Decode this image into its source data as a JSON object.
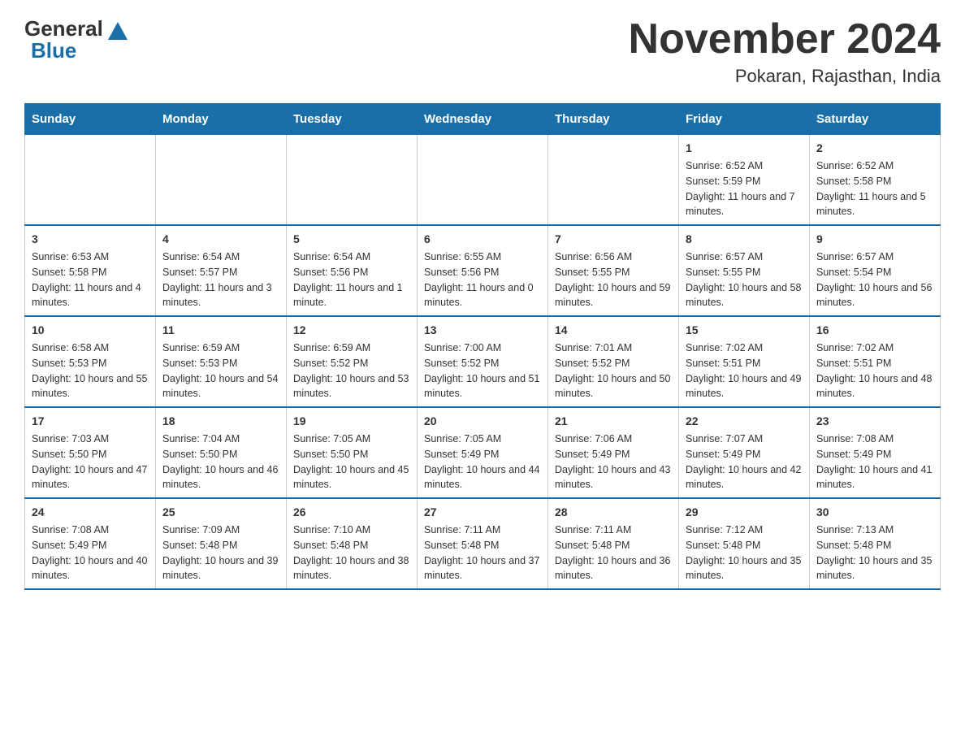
{
  "logo": {
    "general": "General",
    "blue": "Blue"
  },
  "title": {
    "month_year": "November 2024",
    "location": "Pokaran, Rajasthan, India"
  },
  "weekdays": [
    "Sunday",
    "Monday",
    "Tuesday",
    "Wednesday",
    "Thursday",
    "Friday",
    "Saturday"
  ],
  "weeks": [
    [
      {
        "day": "",
        "info": ""
      },
      {
        "day": "",
        "info": ""
      },
      {
        "day": "",
        "info": ""
      },
      {
        "day": "",
        "info": ""
      },
      {
        "day": "",
        "info": ""
      },
      {
        "day": "1",
        "info": "Sunrise: 6:52 AM\nSunset: 5:59 PM\nDaylight: 11 hours and 7 minutes."
      },
      {
        "day": "2",
        "info": "Sunrise: 6:52 AM\nSunset: 5:58 PM\nDaylight: 11 hours and 5 minutes."
      }
    ],
    [
      {
        "day": "3",
        "info": "Sunrise: 6:53 AM\nSunset: 5:58 PM\nDaylight: 11 hours and 4 minutes."
      },
      {
        "day": "4",
        "info": "Sunrise: 6:54 AM\nSunset: 5:57 PM\nDaylight: 11 hours and 3 minutes."
      },
      {
        "day": "5",
        "info": "Sunrise: 6:54 AM\nSunset: 5:56 PM\nDaylight: 11 hours and 1 minute."
      },
      {
        "day": "6",
        "info": "Sunrise: 6:55 AM\nSunset: 5:56 PM\nDaylight: 11 hours and 0 minutes."
      },
      {
        "day": "7",
        "info": "Sunrise: 6:56 AM\nSunset: 5:55 PM\nDaylight: 10 hours and 59 minutes."
      },
      {
        "day": "8",
        "info": "Sunrise: 6:57 AM\nSunset: 5:55 PM\nDaylight: 10 hours and 58 minutes."
      },
      {
        "day": "9",
        "info": "Sunrise: 6:57 AM\nSunset: 5:54 PM\nDaylight: 10 hours and 56 minutes."
      }
    ],
    [
      {
        "day": "10",
        "info": "Sunrise: 6:58 AM\nSunset: 5:53 PM\nDaylight: 10 hours and 55 minutes."
      },
      {
        "day": "11",
        "info": "Sunrise: 6:59 AM\nSunset: 5:53 PM\nDaylight: 10 hours and 54 minutes."
      },
      {
        "day": "12",
        "info": "Sunrise: 6:59 AM\nSunset: 5:52 PM\nDaylight: 10 hours and 53 minutes."
      },
      {
        "day": "13",
        "info": "Sunrise: 7:00 AM\nSunset: 5:52 PM\nDaylight: 10 hours and 51 minutes."
      },
      {
        "day": "14",
        "info": "Sunrise: 7:01 AM\nSunset: 5:52 PM\nDaylight: 10 hours and 50 minutes."
      },
      {
        "day": "15",
        "info": "Sunrise: 7:02 AM\nSunset: 5:51 PM\nDaylight: 10 hours and 49 minutes."
      },
      {
        "day": "16",
        "info": "Sunrise: 7:02 AM\nSunset: 5:51 PM\nDaylight: 10 hours and 48 minutes."
      }
    ],
    [
      {
        "day": "17",
        "info": "Sunrise: 7:03 AM\nSunset: 5:50 PM\nDaylight: 10 hours and 47 minutes."
      },
      {
        "day": "18",
        "info": "Sunrise: 7:04 AM\nSunset: 5:50 PM\nDaylight: 10 hours and 46 minutes."
      },
      {
        "day": "19",
        "info": "Sunrise: 7:05 AM\nSunset: 5:50 PM\nDaylight: 10 hours and 45 minutes."
      },
      {
        "day": "20",
        "info": "Sunrise: 7:05 AM\nSunset: 5:49 PM\nDaylight: 10 hours and 44 minutes."
      },
      {
        "day": "21",
        "info": "Sunrise: 7:06 AM\nSunset: 5:49 PM\nDaylight: 10 hours and 43 minutes."
      },
      {
        "day": "22",
        "info": "Sunrise: 7:07 AM\nSunset: 5:49 PM\nDaylight: 10 hours and 42 minutes."
      },
      {
        "day": "23",
        "info": "Sunrise: 7:08 AM\nSunset: 5:49 PM\nDaylight: 10 hours and 41 minutes."
      }
    ],
    [
      {
        "day": "24",
        "info": "Sunrise: 7:08 AM\nSunset: 5:49 PM\nDaylight: 10 hours and 40 minutes."
      },
      {
        "day": "25",
        "info": "Sunrise: 7:09 AM\nSunset: 5:48 PM\nDaylight: 10 hours and 39 minutes."
      },
      {
        "day": "26",
        "info": "Sunrise: 7:10 AM\nSunset: 5:48 PM\nDaylight: 10 hours and 38 minutes."
      },
      {
        "day": "27",
        "info": "Sunrise: 7:11 AM\nSunset: 5:48 PM\nDaylight: 10 hours and 37 minutes."
      },
      {
        "day": "28",
        "info": "Sunrise: 7:11 AM\nSunset: 5:48 PM\nDaylight: 10 hours and 36 minutes."
      },
      {
        "day": "29",
        "info": "Sunrise: 7:12 AM\nSunset: 5:48 PM\nDaylight: 10 hours and 35 minutes."
      },
      {
        "day": "30",
        "info": "Sunrise: 7:13 AM\nSunset: 5:48 PM\nDaylight: 10 hours and 35 minutes."
      }
    ]
  ]
}
